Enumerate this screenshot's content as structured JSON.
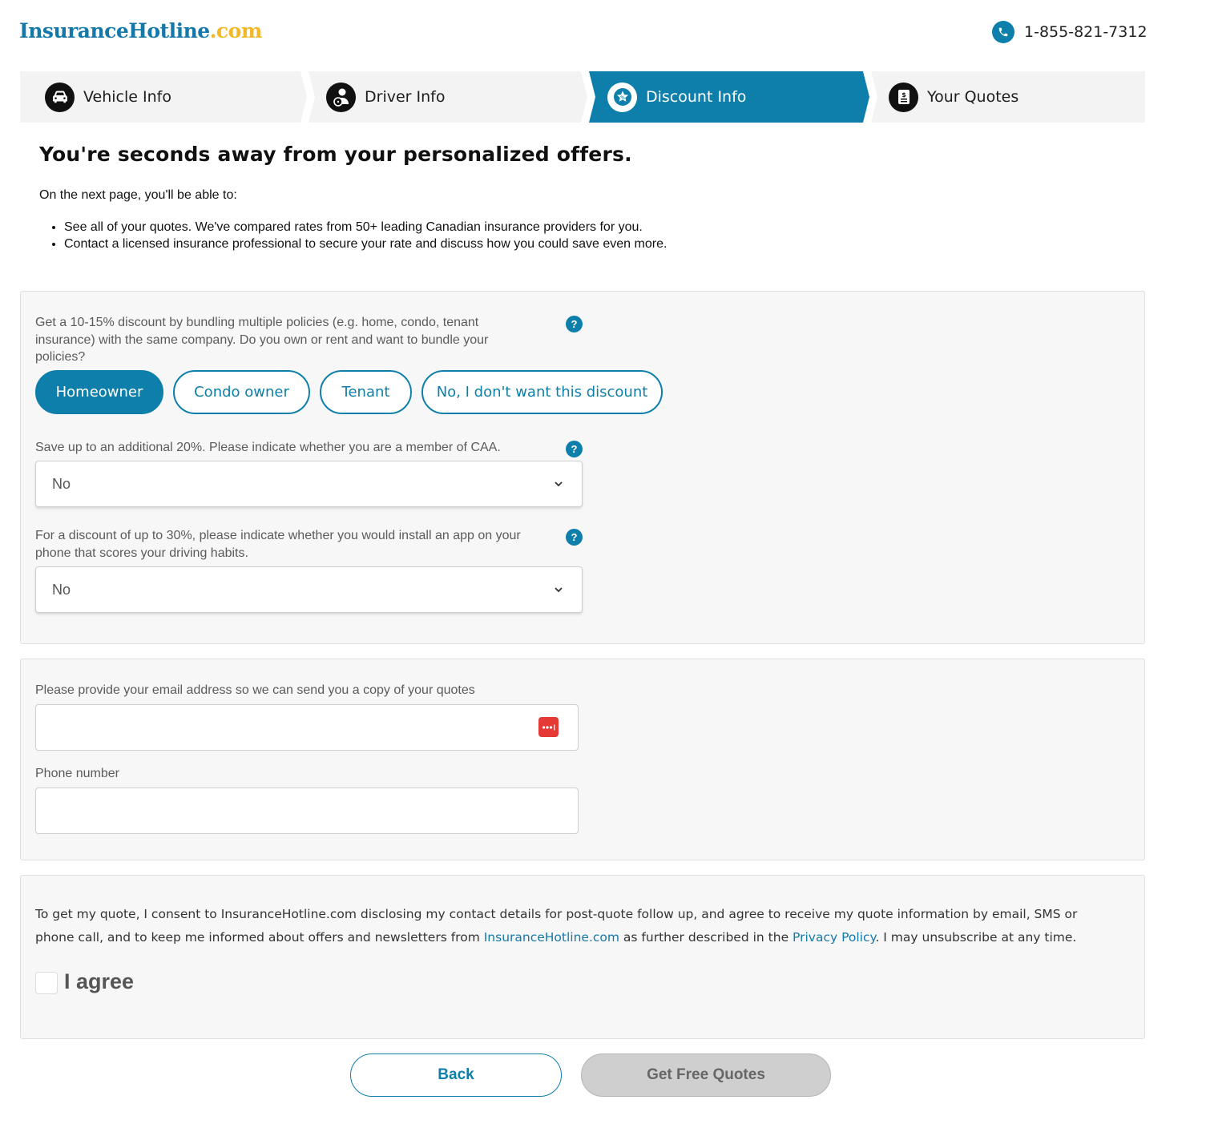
{
  "header": {
    "logo_brand": "InsuranceHotline",
    "logo_tld": ".com",
    "phone": "1-855-821-7312"
  },
  "steps": [
    {
      "label": "Vehicle Info",
      "icon": "car-icon"
    },
    {
      "label": "Driver Info",
      "icon": "driver-icon"
    },
    {
      "label": "Discount Info",
      "icon": "star-discount-icon",
      "active": true
    },
    {
      "label": "Your Quotes",
      "icon": "quotes-document-icon"
    }
  ],
  "intro": {
    "title": "You're seconds away from your personalized offers.",
    "lead": "On the next page, you'll be able to:",
    "bullets": [
      "See all of your quotes. We've compared rates from 50+ leading Canadian insurance providers for you.",
      "Contact a licensed insurance professional to secure your rate and discuss how you could save even more."
    ]
  },
  "discounts": {
    "bundle_question": "Get a 10-15% discount by bundling multiple policies (e.g. home, condo, tenant insurance) with the same company. Do you own or rent and want to bundle your policies?",
    "bundle_options": [
      "Homeowner",
      "Condo owner",
      "Tenant",
      "No, I don't want this discount"
    ],
    "bundle_selected": "Homeowner",
    "caa_question": "Save up to an additional 20%. Please indicate whether you are a member of CAA.",
    "caa_value": "No",
    "app_question": "For a discount of up to 30%, please indicate whether you would install an app on your phone that scores your driving habits.",
    "app_value": "No",
    "help_glyph": "?"
  },
  "contact": {
    "email_label": "Please provide your email address so we can send you a copy of your quotes",
    "email_value": "",
    "phone_label": "Phone number",
    "phone_value": ""
  },
  "consent": {
    "text_part1": "To get my quote, I consent to InsuranceHotline.com disclosing my contact details for post-quote follow up, and agree to receive my quote information by email, SMS or phone call, and to keep me informed about offers and newsletters from ",
    "link_site": "InsuranceHotline.com",
    "text_part2": " as further described in the ",
    "link_policy": "Privacy Policy",
    "text_part3": ". I may unsubscribe at any time.",
    "agree_label": "I agree"
  },
  "actions": {
    "back": "Back",
    "get_quotes": "Get Free Quotes"
  },
  "colors": {
    "primary": "#0e7fab",
    "logo_blue": "#1478a8",
    "logo_yellow": "#f2b825",
    "disabled": "#cfcfcf"
  }
}
